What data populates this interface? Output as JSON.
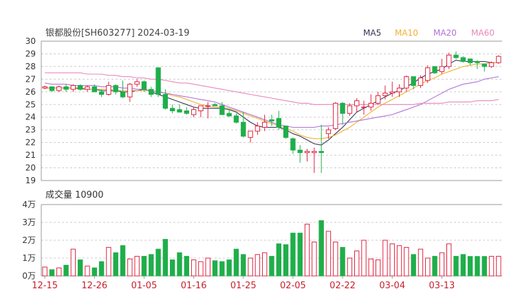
{
  "header": {
    "title": "银都股份[SH603277] 2024-03-19",
    "ma_labels": [
      {
        "label": "MA5",
        "color": "#333355"
      },
      {
        "label": "MA10",
        "color": "#f0b030"
      },
      {
        "label": "MA20",
        "color": "#b070d8"
      },
      {
        "label": "MA60",
        "color": "#e888b8"
      }
    ]
  },
  "colors": {
    "up": "#e0223f",
    "down": "#1fae4a",
    "grid": "#cccccc",
    "axis": "#333333",
    "date_label": "#c8202c"
  },
  "chart_data": [
    {
      "type": "candlestick",
      "title": "银都股份[SH603277] 2024-03-19",
      "ylim": [
        19,
        30
      ],
      "y_ticks": [
        "30",
        "29",
        "28",
        "27",
        "26",
        "25",
        "24",
        "23",
        "22",
        "21",
        "20",
        "19"
      ],
      "x_tick_labels": [
        "12-15",
        "12-26",
        "01-05",
        "01-16",
        "01-25",
        "02-05",
        "02-22",
        "03-04",
        "03-13"
      ],
      "x_tick_index": [
        0,
        7,
        14,
        21,
        28,
        35,
        42,
        49,
        56
      ],
      "candles": [
        [
          26.3,
          26.5,
          26.2,
          26.4
        ],
        [
          26.4,
          26.4,
          26.0,
          26.1
        ],
        [
          26.1,
          26.5,
          26.0,
          26.4
        ],
        [
          26.4,
          26.6,
          26.0,
          26.2
        ],
        [
          26.2,
          26.6,
          26.0,
          26.5
        ],
        [
          26.5,
          26.6,
          26.1,
          26.2
        ],
        [
          26.2,
          26.5,
          26.0,
          26.4
        ],
        [
          26.4,
          26.6,
          26.2,
          26.0
        ],
        [
          26.0,
          26.2,
          25.6,
          25.8
        ],
        [
          25.8,
          26.8,
          25.7,
          26.5
        ],
        [
          26.5,
          26.6,
          25.8,
          26.0
        ],
        [
          26.0,
          26.9,
          25.5,
          25.6
        ],
        [
          25.6,
          26.7,
          25.2,
          26.6
        ],
        [
          26.6,
          27.0,
          26.4,
          26.8
        ],
        [
          26.8,
          26.9,
          26.0,
          26.2
        ],
        [
          26.2,
          26.4,
          25.6,
          25.8
        ],
        [
          27.9,
          27.9,
          25.6,
          25.8
        ],
        [
          25.8,
          26.2,
          24.6,
          24.7
        ],
        [
          24.7,
          25.0,
          24.3,
          24.5
        ],
        [
          24.6,
          25.0,
          24.4,
          24.4
        ],
        [
          24.5,
          24.8,
          24.2,
          24.3
        ],
        [
          24.2,
          24.8,
          24.0,
          24.6
        ],
        [
          24.5,
          24.9,
          24.0,
          24.9
        ],
        [
          24.9,
          25.2,
          23.9,
          24.9
        ],
        [
          25.0,
          25.1,
          24.9,
          24.9
        ],
        [
          24.9,
          25.2,
          24.2,
          24.2
        ],
        [
          24.3,
          24.6,
          24.0,
          24.1
        ],
        [
          24.1,
          24.3,
          23.5,
          23.6
        ],
        [
          23.6,
          24.4,
          22.4,
          22.5
        ],
        [
          22.4,
          22.8,
          22.0,
          22.9
        ],
        [
          22.9,
          23.6,
          22.6,
          23.3
        ],
        [
          23.2,
          24.2,
          22.9,
          23.6
        ],
        [
          23.8,
          24.2,
          23.3,
          23.7
        ],
        [
          23.9,
          24.5,
          23.0,
          23.2
        ],
        [
          23.3,
          23.3,
          22.3,
          22.4
        ],
        [
          22.3,
          22.4,
          21.1,
          21.4
        ],
        [
          21.4,
          21.8,
          20.4,
          21.2
        ],
        [
          21.2,
          21.5,
          20.5,
          21.3
        ],
        [
          21.2,
          21.6,
          19.6,
          21.3
        ],
        [
          21.3,
          23.4,
          19.6,
          21.2
        ],
        [
          22.7,
          23.2,
          22.3,
          23.0
        ],
        [
          23.1,
          25.2,
          23.0,
          25.1
        ],
        [
          25.1,
          25.2,
          23.4,
          24.3
        ],
        [
          24.3,
          25.1,
          24.1,
          24.9
        ],
        [
          24.9,
          25.5,
          24.4,
          25.3
        ],
        [
          24.8,
          25.3,
          24.2,
          24.8
        ],
        [
          24.8,
          25.8,
          24.5,
          25.1
        ],
        [
          25.1,
          26.0,
          25.0,
          25.7
        ],
        [
          25.7,
          26.5,
          25.4,
          25.9
        ],
        [
          25.9,
          26.8,
          25.6,
          26.0
        ],
        [
          26.0,
          26.6,
          25.6,
          26.3
        ],
        [
          26.3,
          27.3,
          26.0,
          27.2
        ],
        [
          27.2,
          27.2,
          26.2,
          26.5
        ],
        [
          26.5,
          27.3,
          26.3,
          27.1
        ],
        [
          26.9,
          28.1,
          26.7,
          27.9
        ],
        [
          28.0,
          28.0,
          27.4,
          27.5
        ],
        [
          27.6,
          28.6,
          27.4,
          28.0
        ],
        [
          28.0,
          29.1,
          27.8,
          28.9
        ],
        [
          28.9,
          29.2,
          28.6,
          28.7
        ],
        [
          28.7,
          28.8,
          28.3,
          28.4
        ],
        [
          28.6,
          28.6,
          28.1,
          28.3
        ],
        [
          28.4,
          28.5,
          27.8,
          28.3
        ],
        [
          28.2,
          28.2,
          27.6,
          28.0
        ],
        [
          28.0,
          28.4,
          27.9,
          28.3
        ],
        [
          28.3,
          28.9,
          28.2,
          28.8
        ]
      ],
      "ma5": [
        26.3,
        26.3,
        26.3,
        26.3,
        26.3,
        26.3,
        26.2,
        26.2,
        26.1,
        26.1,
        26.1,
        26.0,
        26.0,
        26.1,
        26.2,
        26.0,
        25.8,
        25.6,
        25.4,
        25.2,
        25.0,
        24.8,
        24.7,
        24.7,
        24.7,
        24.7,
        24.6,
        24.4,
        24.0,
        23.6,
        23.3,
        23.2,
        23.2,
        23.2,
        23.0,
        22.7,
        22.5,
        22.2,
        21.9,
        21.8,
        22.2,
        22.7,
        23.2,
        23.8,
        24.4,
        24.7,
        25.0,
        25.3,
        25.6,
        25.9,
        26.1,
        26.4,
        26.7,
        27.1,
        27.4,
        27.6,
        27.8,
        28.2,
        28.5,
        28.4,
        28.4,
        28.4,
        28.4,
        28.3,
        28.3
      ],
      "ma10": [
        26.3,
        26.3,
        26.3,
        26.3,
        26.3,
        26.2,
        26.2,
        26.2,
        26.2,
        26.2,
        26.1,
        26.1,
        26.1,
        26.1,
        26.1,
        26.1,
        26.0,
        25.9,
        25.7,
        25.6,
        25.4,
        25.2,
        25.0,
        24.9,
        24.8,
        24.8,
        24.7,
        24.5,
        24.3,
        24.1,
        23.9,
        23.7,
        23.5,
        23.3,
        23.1,
        22.9,
        22.6,
        22.4,
        22.3,
        22.3,
        22.4,
        22.6,
        22.9,
        23.2,
        23.6,
        24.0,
        24.4,
        24.8,
        25.1,
        25.4,
        25.7,
        26.0,
        26.3,
        26.6,
        26.9,
        27.1,
        27.4,
        27.6,
        27.8,
        28.0,
        28.1,
        28.2,
        28.2,
        28.3,
        28.3
      ],
      "ma20": [
        26.7,
        26.6,
        26.6,
        26.6,
        26.5,
        26.5,
        26.5,
        26.5,
        26.4,
        26.4,
        26.4,
        26.3,
        26.3,
        26.2,
        26.2,
        26.1,
        26.0,
        25.9,
        25.8,
        25.7,
        25.6,
        25.5,
        25.4,
        25.3,
        25.2,
        25.0,
        24.8,
        24.6,
        24.4,
        24.2,
        24.0,
        23.8,
        23.6,
        23.4,
        23.3,
        23.2,
        23.2,
        23.2,
        23.2,
        23.3,
        23.3,
        23.4,
        23.5,
        23.6,
        23.7,
        23.8,
        23.9,
        24.0,
        24.1,
        24.2,
        24.4,
        24.6,
        24.8,
        25.0,
        25.3,
        25.6,
        25.9,
        26.2,
        26.4,
        26.6,
        26.7,
        26.8,
        27.0,
        27.1,
        27.2
      ],
      "ma60": [
        27.5,
        27.5,
        27.5,
        27.5,
        27.5,
        27.5,
        27.4,
        27.4,
        27.4,
        27.3,
        27.3,
        27.2,
        27.2,
        27.1,
        27.1,
        27.0,
        27.0,
        26.9,
        26.8,
        26.7,
        26.7,
        26.6,
        26.5,
        26.4,
        26.3,
        26.2,
        26.1,
        26.0,
        25.9,
        25.8,
        25.7,
        25.6,
        25.5,
        25.4,
        25.3,
        25.2,
        25.1,
        25.1,
        25.0,
        25.0,
        25.0,
        25.0,
        25.0,
        25.0,
        25.0,
        25.0,
        25.0,
        25.0,
        25.0,
        25.0,
        25.0,
        25.0,
        25.0,
        25.1,
        25.1,
        25.1,
        25.1,
        25.2,
        25.2,
        25.2,
        25.2,
        25.3,
        25.3,
        25.3,
        25.4
      ]
    },
    {
      "type": "bar",
      "title": "成交量 10900",
      "ylim": [
        0,
        40000
      ],
      "y_ticks": [
        "4万",
        "3万",
        "2万",
        "1万",
        "0万"
      ],
      "volumes": [
        5000,
        3500,
        4500,
        6000,
        15000,
        9000,
        5500,
        4500,
        8000,
        16000,
        13000,
        17000,
        9500,
        11000,
        11000,
        12000,
        15000,
        20500,
        9000,
        13000,
        11000,
        9000,
        8000,
        10000,
        8500,
        8000,
        9000,
        15000,
        12000,
        10000,
        12000,
        13000,
        11000,
        18000,
        17500,
        24000,
        24000,
        29000,
        19000,
        31000,
        25000,
        19000,
        16000,
        10000,
        14000,
        20000,
        9500,
        9000,
        20000,
        18000,
        17000,
        16000,
        12000,
        15000,
        10000,
        11000,
        13000,
        18000,
        11000,
        12000,
        10900,
        10900,
        10900,
        11000,
        11000
      ]
    }
  ]
}
